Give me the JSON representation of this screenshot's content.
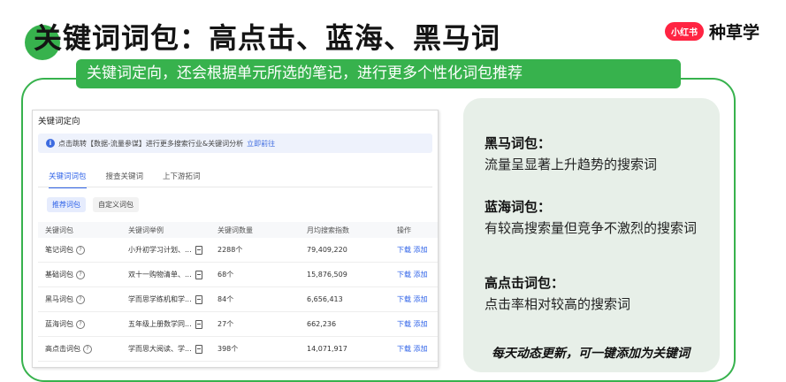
{
  "title": "关键词词包：高点击、蓝海、黑马词",
  "brand": {
    "logo_text": "小红书",
    "name": "种草学"
  },
  "banner": "关键词定向，还会根据单元所选的笔记，进行更多个性化词包推荐",
  "screenshot": {
    "title": "关键词定向",
    "info": {
      "text": "点击跳转【数据-流量参谋】进行更多搜索行业&关键词分析",
      "link": "立即前往"
    },
    "tabs": [
      "关键词词包",
      "搜查关键词",
      "上下游拓词"
    ],
    "subtabs": [
      "推荐词包",
      "自定义词包"
    ],
    "table": {
      "headers": [
        "关键词包",
        "关键词举例",
        "关键词数量",
        "月均搜索指数",
        "操作"
      ],
      "rows": [
        {
          "name": "笔记词包",
          "example": "小升初学习计划、...",
          "count": "2288个",
          "index": "79,409,220",
          "actions": "下载 添加"
        },
        {
          "name": "基础词包",
          "example": "双十一购物清单、...",
          "count": "68个",
          "index": "15,876,509",
          "actions": "下载 添加"
        },
        {
          "name": "黑马词包",
          "example": "学而思学练机和学...",
          "count": "84个",
          "index": "6,656,413",
          "actions": "下载 添加"
        },
        {
          "name": "蓝海词包",
          "example": "五年级上册数学同...",
          "count": "27个",
          "index": "662,236",
          "actions": "下载 添加"
        },
        {
          "name": "高点击词包",
          "example": "学而思大阅读、学...",
          "count": "398个",
          "index": "14,071,917",
          "actions": "下载 添加"
        }
      ]
    }
  },
  "panel": {
    "blocks": [
      {
        "heading": "黑马词包：",
        "text": "流量呈显著上升趋势的搜索词"
      },
      {
        "heading": "蓝海词包：",
        "text": "有较高搜索量但竞争不激烈的搜索词"
      },
      {
        "heading": "高点击词包：",
        "text": "点击率相对较高的搜索词"
      }
    ],
    "footer": "每天动态更新，可一键添加为关键词"
  },
  "colors": {
    "accent_green": "#37b24d",
    "panel_bg": "#e7efe8",
    "link_blue": "#2e62e8",
    "brand_red": "#ff2442"
  },
  "icons": {
    "info": "info-icon",
    "question": "question-icon",
    "doc": "doc-icon"
  }
}
